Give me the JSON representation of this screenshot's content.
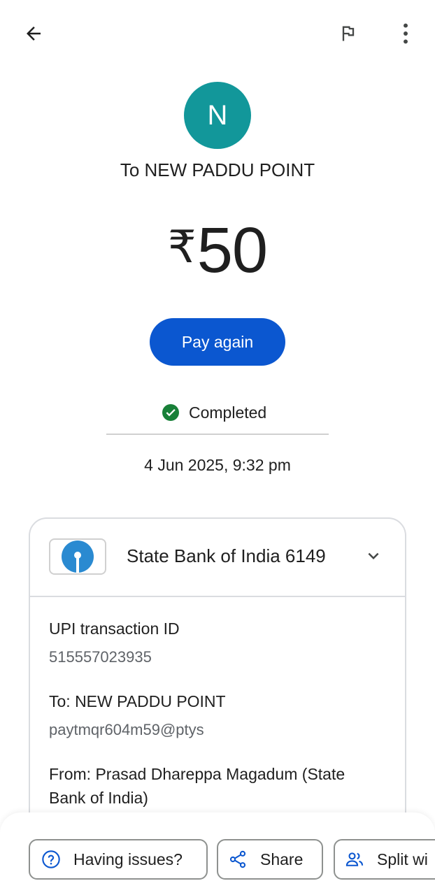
{
  "header": {
    "back_icon": "arrow-back-icon",
    "report_icon": "flag-icon",
    "more_icon": "more-vertical-icon"
  },
  "payee": {
    "avatar_letter": "N",
    "avatar_color": "#12979a",
    "title": "To NEW PADDU POINT"
  },
  "amount": {
    "currency": "₹",
    "value": "50"
  },
  "actions": {
    "pay_again_label": "Pay again",
    "accent_color": "#0b57d0"
  },
  "status": {
    "label": "Completed",
    "color": "#188038"
  },
  "datetime": "4 Jun 2025, 9:32 pm",
  "account": {
    "bank_label": "State Bank of India 6149",
    "expand_icon": "chevron-down-icon"
  },
  "details": {
    "txn_id_label": "UPI transaction ID",
    "txn_id_value": "515557023935",
    "to_label": "To: NEW PADDU POINT",
    "to_value": "paytmqr604m59@ptys",
    "from_label_line1": "From: Prasad  Dhareppa Magadum (State",
    "from_label_line2": "Bank of India)"
  },
  "bottom_actions": {
    "issues_label": "Having issues?",
    "share_label": "Share",
    "split_label": "Split wi"
  }
}
